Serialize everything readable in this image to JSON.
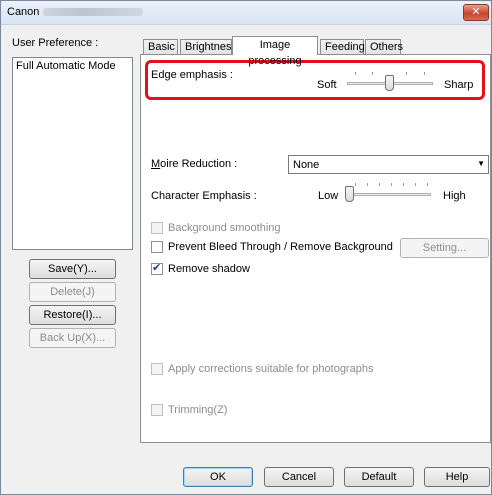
{
  "window": {
    "title": "Canon",
    "close_label": "✕"
  },
  "user_preference": {
    "label": "User Preference :",
    "items": [
      "Full Automatic Mode"
    ],
    "buttons": {
      "save": "Save(Y)...",
      "delete": "Delete(J)",
      "restore": "Restore(I)...",
      "backup": "Back Up(X)..."
    }
  },
  "tabs": [
    {
      "label": "Basic",
      "active": false
    },
    {
      "label": "Brightness",
      "active": false
    },
    {
      "label": "Image processing",
      "active": true
    },
    {
      "label": "Feeding",
      "active": false
    },
    {
      "label": "Others",
      "active": false
    }
  ],
  "edge_emphasis": {
    "label": "Edge emphasis :",
    "min_label": "Soft",
    "max_label": "Sharp",
    "level": 0.5
  },
  "moire": {
    "label": "Moire Reduction :",
    "value": "None"
  },
  "character_emphasis": {
    "label": "Character Emphasis :",
    "min_label": "Low",
    "max_label": "High",
    "level": 0.0
  },
  "options": {
    "background_smoothing": {
      "label": "Background smoothing",
      "checked": false,
      "enabled": false
    },
    "prevent_bleed": {
      "label": "Prevent Bleed Through / Remove Background",
      "checked": false,
      "enabled": true
    },
    "setting_button": "Setting...",
    "remove_shadow": {
      "label": "Remove shadow",
      "checked": true,
      "enabled": true
    },
    "apply_corrections": {
      "label": "Apply corrections suitable for photographs",
      "checked": false,
      "enabled": false
    },
    "trimming": {
      "label": "Trimming(Z)",
      "checked": false,
      "enabled": false
    }
  },
  "footer": {
    "ok": "OK",
    "cancel": "Cancel",
    "default": "Default",
    "help": "Help"
  }
}
